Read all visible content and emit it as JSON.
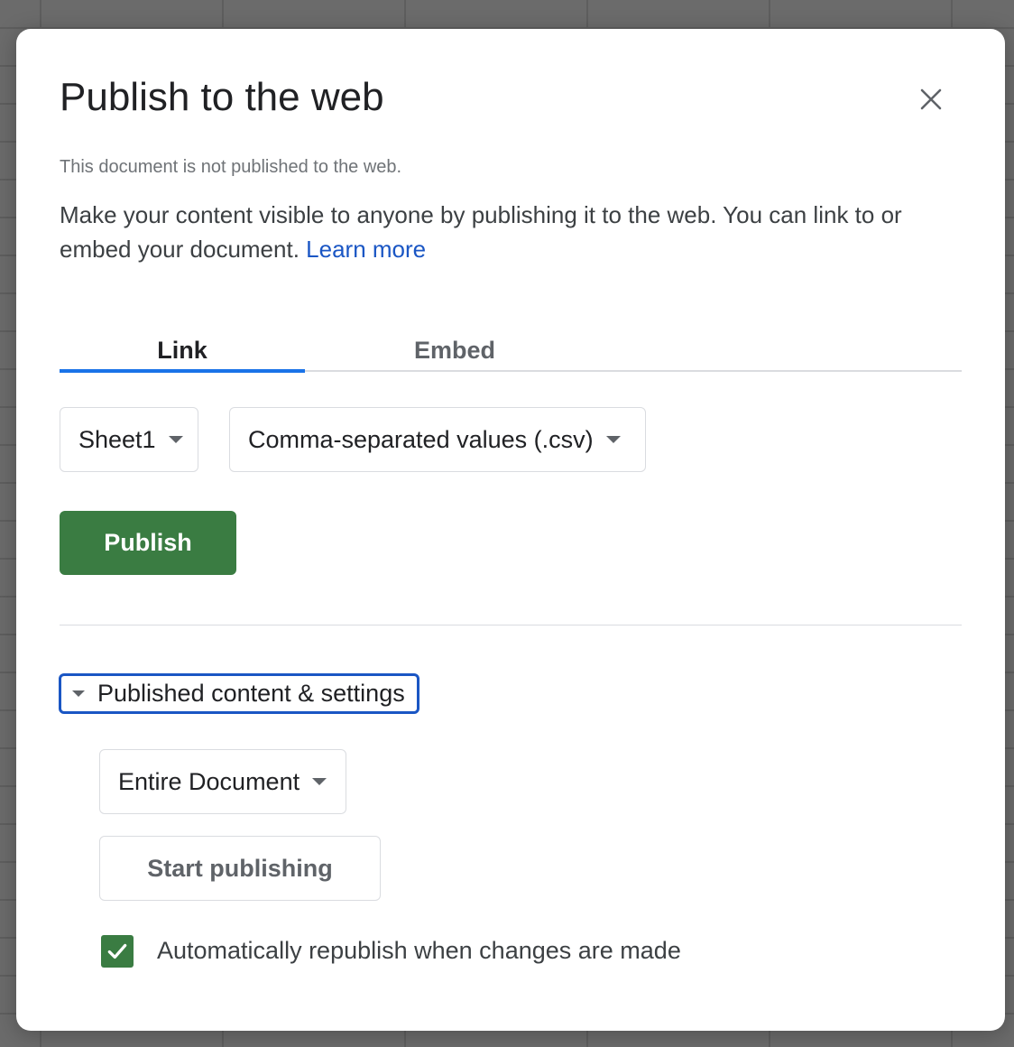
{
  "dialog": {
    "title": "Publish to the web",
    "close_icon": "close-icon",
    "status": "This document is not published to the web.",
    "description": "Make your content visible to anyone by publishing it to the web. You can link to or embed your document.",
    "learn_more": "Learn more"
  },
  "tabs": [
    {
      "label": "Link",
      "selected": true
    },
    {
      "label": "Embed",
      "selected": false
    }
  ],
  "link_options": {
    "sheet_select": "Sheet1",
    "format_select": "Comma-separated values (.csv)",
    "caret_icon": "chevron-down-icon"
  },
  "publish_button": "Publish",
  "published_settings": {
    "toggle_label": "Published content & settings",
    "toggle_icon": "triangle-down-icon",
    "expanded": true,
    "scope_select": "Entire Document",
    "start_button": "Start publishing",
    "auto_republish": {
      "label": "Automatically republish when changes are made",
      "checked": true,
      "icon": "check-icon"
    }
  },
  "colors": {
    "accent_blue": "#1a73e8",
    "link_blue": "#1a56c4",
    "primary_green": "#3a7c42"
  }
}
